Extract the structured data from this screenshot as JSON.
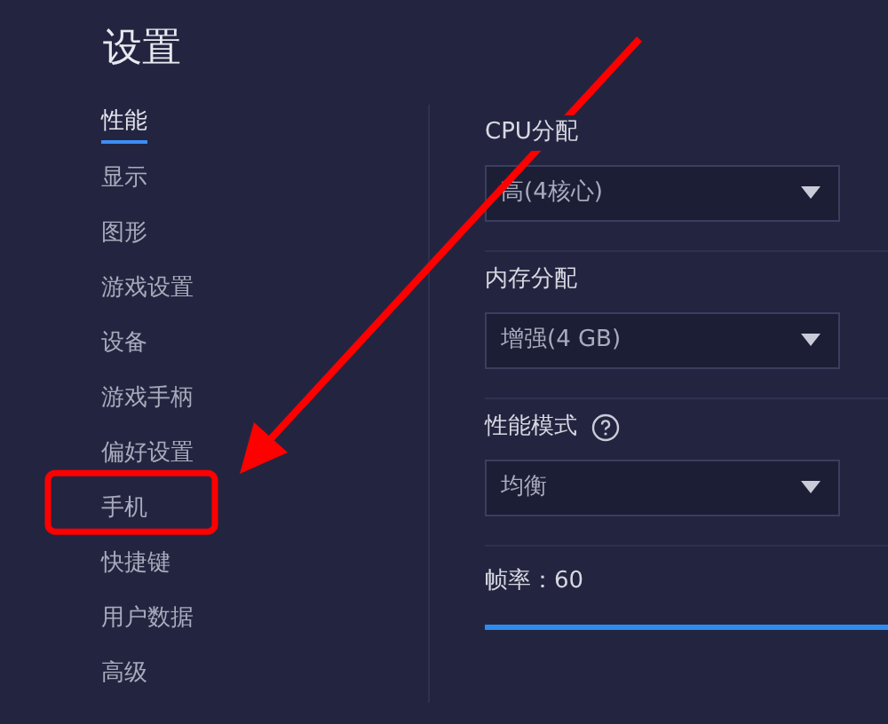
{
  "window": {
    "title": "设置"
  },
  "sidebar": {
    "items": [
      {
        "label": "性能",
        "selected": true,
        "highlighted": false
      },
      {
        "label": "显示",
        "selected": false,
        "highlighted": false
      },
      {
        "label": "图形",
        "selected": false,
        "highlighted": false
      },
      {
        "label": "游戏设置",
        "selected": false,
        "highlighted": false
      },
      {
        "label": "设备",
        "selected": false,
        "highlighted": false
      },
      {
        "label": "游戏手柄",
        "selected": false,
        "highlighted": false
      },
      {
        "label": "偏好设置",
        "selected": false,
        "highlighted": false
      },
      {
        "label": "手机",
        "selected": false,
        "highlighted": true
      },
      {
        "label": "快捷键",
        "selected": false,
        "highlighted": false
      },
      {
        "label": "用户数据",
        "selected": false,
        "highlighted": false
      },
      {
        "label": "高级",
        "selected": false,
        "highlighted": false
      }
    ]
  },
  "settings": [
    {
      "label": "CPU分配",
      "value": "高(4核心)",
      "help": false
    },
    {
      "label": "内存分配",
      "value": "增强(4 GB)",
      "help": false
    },
    {
      "label": "性能模式",
      "value": "均衡",
      "help": true
    }
  ],
  "frame_rate": {
    "label": "帧率：60",
    "level": 1
  }
}
